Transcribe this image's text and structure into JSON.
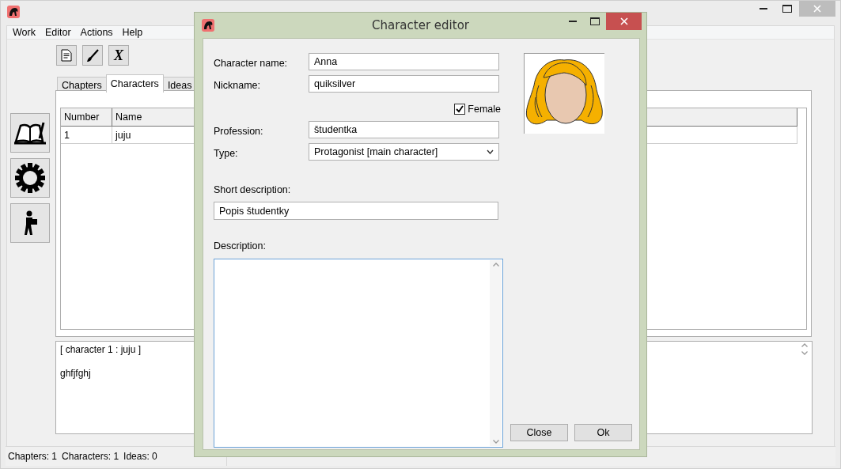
{
  "menu": [
    "Work",
    "Editor",
    "Actions",
    "Help"
  ],
  "toolbar": [
    {
      "kind": "document"
    },
    {
      "kind": "brush"
    },
    {
      "kind": "letter",
      "label": "X"
    }
  ],
  "tabs": [
    {
      "label": "Chapters",
      "selected": false
    },
    {
      "label": "Characters",
      "selected": true
    },
    {
      "label": "Ideas",
      "selected": false
    }
  ],
  "side_buttons": [
    {
      "kind": "book"
    },
    {
      "kind": "gear"
    },
    {
      "kind": "person"
    }
  ],
  "table": {
    "columns": [
      "Number",
      "Name"
    ],
    "rows": [
      [
        "1",
        "juju"
      ]
    ]
  },
  "preview": {
    "lines": [
      "[ character 1 : juju ]",
      "ghfjfghj"
    ]
  },
  "status_bar": {
    "counts": [
      "Chapters: 1",
      "Characters: 1",
      "Ideas: 0"
    ]
  },
  "dialog": {
    "title": "Character editor",
    "fields": [
      {
        "label": "Character name:",
        "value": "Anna"
      },
      {
        "label": "Nickname:",
        "value": "quiksilver"
      }
    ],
    "female": {
      "label": "Female",
      "checked": true
    },
    "profession": {
      "label": "Profession:",
      "value": "študentka"
    },
    "type": {
      "label": "Type:",
      "value": "Protagonist [main character]"
    },
    "short_description": {
      "label": "Short description:",
      "value": "Popis študentky"
    },
    "description": {
      "label": "Description:"
    },
    "buttons": [
      "Close",
      "Ok"
    ]
  }
}
